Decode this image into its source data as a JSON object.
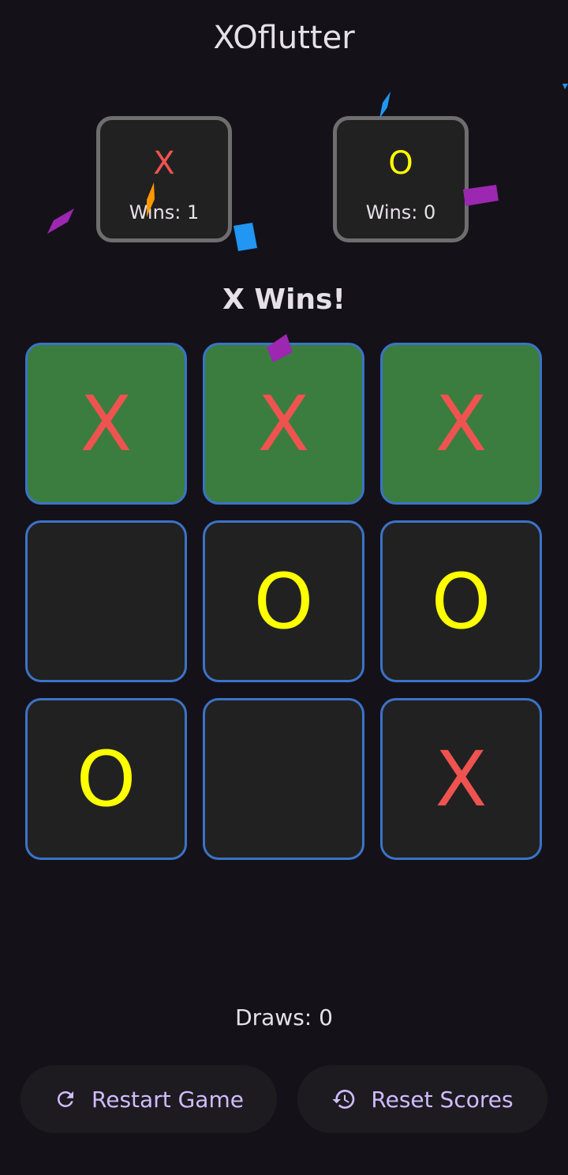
{
  "app": {
    "title": "XOflutter"
  },
  "players": {
    "x": {
      "symbol": "X",
      "wins_label": "Wins: 1",
      "color": "#ef5350"
    },
    "o": {
      "symbol": "O",
      "wins_label": "Wins: 0",
      "color": "#ffff00"
    }
  },
  "status": "X Wins!",
  "board": {
    "cells": [
      {
        "value": "X",
        "winning": true
      },
      {
        "value": "X",
        "winning": true
      },
      {
        "value": "X",
        "winning": true
      },
      {
        "value": "",
        "winning": false
      },
      {
        "value": "O",
        "winning": false
      },
      {
        "value": "O",
        "winning": false
      },
      {
        "value": "O",
        "winning": false
      },
      {
        "value": "",
        "winning": false
      },
      {
        "value": "X",
        "winning": false
      }
    ],
    "colors": {
      "x": "#ef5350",
      "o": "#ffff00",
      "win_background": "#3b7d3f",
      "cell_background": "#212121",
      "cell_border": "#3b73c8"
    }
  },
  "draws_label": "Draws: 0",
  "buttons": {
    "restart": {
      "label": "Restart Game",
      "icon": "refresh-icon"
    },
    "reset": {
      "label": "Reset Scores",
      "icon": "history-icon"
    }
  },
  "colors": {
    "background": "#141218",
    "accent": "#d0bcff",
    "confetti": [
      "#9c27b0",
      "#2196f3",
      "#ff9800"
    ]
  }
}
